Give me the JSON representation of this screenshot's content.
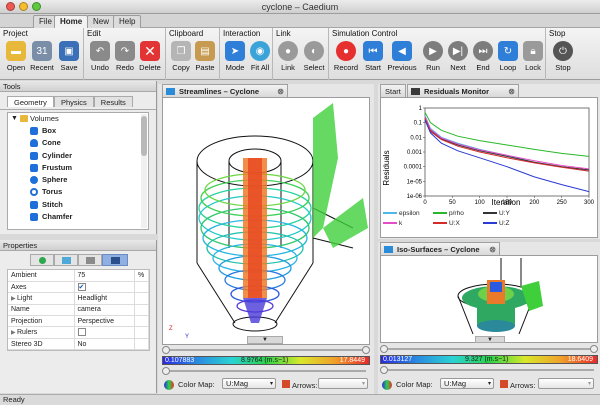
{
  "window": {
    "title": "cyclone – Caedium"
  },
  "menu_tabs": [
    "File",
    "Home",
    "New",
    "Help"
  ],
  "ribbon": {
    "groups": [
      {
        "label": "Project",
        "buttons": [
          "Open",
          "Recent",
          "Save"
        ]
      },
      {
        "label": "Edit",
        "buttons": [
          "Undo",
          "Redo",
          "Delete"
        ]
      },
      {
        "label": "Clipboard",
        "buttons": [
          "Copy",
          "Paste"
        ]
      },
      {
        "label": "Interaction",
        "buttons": [
          "Mode",
          "Fit All"
        ]
      },
      {
        "label": "Link",
        "buttons": [
          "Link",
          "Select"
        ]
      },
      {
        "label": "Simulation Control",
        "buttons": [
          "Record",
          "Start",
          "Previous",
          "Run",
          "Next",
          "End",
          "Loop",
          "Lock"
        ]
      },
      {
        "label": "Stop",
        "buttons": [
          "Stop"
        ]
      }
    ]
  },
  "tools": {
    "header": "Tools",
    "tabs": [
      "Geometry",
      "Physics",
      "Results"
    ],
    "root": "Volumes",
    "items": [
      "Box",
      "Cone",
      "Cylinder",
      "Frustum",
      "Sphere",
      "Torus",
      "Stitch",
      "Chamfer"
    ]
  },
  "properties": {
    "header": "Properties",
    "rows": [
      {
        "name": "Ambient",
        "value": "75",
        "unit": "%"
      },
      {
        "name": "Axes",
        "value": "✔",
        "unit": ""
      },
      {
        "name": "Light",
        "value": "Headlight",
        "unit": ""
      },
      {
        "name": "Name",
        "value": "camera",
        "unit": ""
      },
      {
        "name": "Projection",
        "value": "Perspective",
        "unit": ""
      },
      {
        "name": "Rulers",
        "value": "",
        "unit": ""
      },
      {
        "name": "Stereo 3D",
        "value": "No",
        "unit": ""
      }
    ]
  },
  "streamlines": {
    "tab": "Streamlines – Cyclone",
    "cb_min": "0.107883",
    "cb_mid": "8.9764 (m.s−1)",
    "cb_max": "17.8449",
    "color_map_label": "Color Map:",
    "color_map_value": "U:Mag",
    "arrows_label": "Arrows:"
  },
  "isosurfaces": {
    "tab": "Iso-Surfaces – Cyclone",
    "cb_min": "0.013127",
    "cb_mid": "9.327 (m.s−1)",
    "cb_max": "18.6409",
    "color_map_label": "Color Map:",
    "color_map_value": "U:Mag",
    "arrows_label": "Arrows:"
  },
  "residuals": {
    "start_tab": "Start",
    "tab": "Residuals Monitor",
    "ylabel": "Residuals",
    "xlabel": "Iteration",
    "legend": [
      "epsilon",
      "p/rho",
      "U:Y",
      "k",
      "U:X",
      "U:Z"
    ]
  },
  "chart_data": {
    "type": "line",
    "xlabel": "Iteration",
    "ylabel": "Residuals",
    "xlim": [
      0,
      300
    ],
    "ylim_log10": [
      -6,
      0
    ],
    "x_ticks": [
      0,
      50,
      100,
      150,
      200,
      250,
      300
    ],
    "y_ticks": [
      "1e-06",
      "1e-05",
      "0.0001",
      "0.001",
      "0.01",
      "0.1",
      "1"
    ],
    "x": [
      0,
      10,
      30,
      60,
      100,
      150,
      200,
      250,
      300
    ],
    "series": [
      {
        "name": "epsilon",
        "color": "#4ab8e8",
        "values": [
          0.3,
          0.04,
          0.01,
          0.004,
          0.0015,
          0.0006,
          0.0002,
          0.0001,
          5e-05
        ]
      },
      {
        "name": "p/rho",
        "color": "#29b829",
        "values": [
          0.5,
          0.1,
          0.03,
          0.012,
          0.006,
          0.003,
          0.0015,
          0.0008,
          0.0005
        ]
      },
      {
        "name": "U:Y",
        "color": "#333333",
        "values": [
          0.2,
          0.03,
          0.008,
          0.003,
          0.0012,
          0.0005,
          0.0002,
          0.0001,
          6e-05
        ]
      },
      {
        "name": "k",
        "color": "#e64ec8",
        "values": [
          0.25,
          0.035,
          0.009,
          0.0035,
          0.0014,
          0.0006,
          0.00025,
          0.00012,
          7e-05
        ]
      },
      {
        "name": "U:X",
        "color": "#d42a2a",
        "values": [
          0.2,
          0.025,
          0.007,
          0.0025,
          0.001,
          0.0004,
          0.00018,
          9e-05,
          5e-05
        ]
      },
      {
        "name": "U:Z",
        "color": "#2a3ad4",
        "values": [
          0.15,
          0.02,
          0.004,
          0.0012,
          0.0004,
          0.0001,
          2e-05,
          6e-06,
          2e-06
        ]
      }
    ]
  },
  "status": "Ready"
}
